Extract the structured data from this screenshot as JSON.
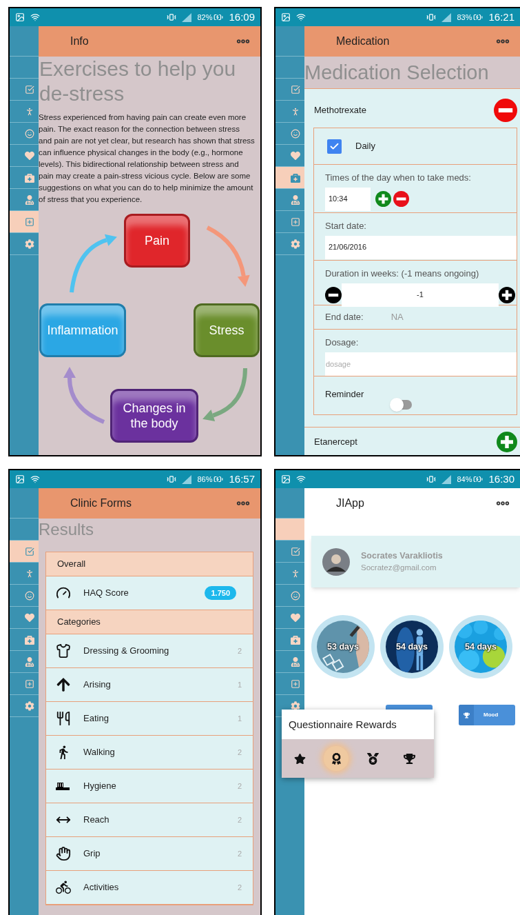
{
  "panels": [
    {
      "kind": "info",
      "status": {
        "battery": "82%",
        "time": "16:09"
      },
      "header": {
        "title": "Info"
      },
      "sidebar": [
        {
          "kind": "blank",
          "selected": false
        },
        {
          "kind": "checklist",
          "selected": false
        },
        {
          "kind": "person",
          "selected": false
        },
        {
          "kind": "smiley",
          "selected": false
        },
        {
          "kind": "heart",
          "selected": false
        },
        {
          "kind": "medkit",
          "selected": false
        },
        {
          "kind": "doctor",
          "selected": false
        },
        {
          "kind": "plus",
          "selected": true
        },
        {
          "kind": "gear",
          "selected": false
        }
      ],
      "title": "Exercises to help you de-stress",
      "paragraph": "Stress experienced from having pain can create even more pain. The exact reason for the connection between stress and pain are not yet clear, but research has shown that stress can influence physical changes in the body (e.g., hormone levels). This bidirectional relationship between stress and pain may create a pain-stress vicious cycle. Below are some suggestions on what you can do to help minimize the amount of stress that you experience.",
      "diagram": {
        "nodes": [
          {
            "label": "Pain",
            "color": "#e0262b"
          },
          {
            "label": "Stress",
            "color": "#6a8e2c"
          },
          {
            "label": "Changes in the body",
            "color": "#6b319e"
          },
          {
            "label": "Inflammation",
            "color": "#2ba7e4"
          }
        ],
        "arrows": [
          {
            "color": "#f4977a"
          },
          {
            "color": "#7aa880"
          },
          {
            "color": "#a48ccc"
          },
          {
            "color": "#4fc3f0"
          }
        ]
      }
    },
    {
      "kind": "medication",
      "status": {
        "battery": "83%",
        "time": "16:21"
      },
      "header": {
        "title": "Medication"
      },
      "sidebar": [
        {
          "kind": "blank",
          "selected": false
        },
        {
          "kind": "checklist",
          "selected": false
        },
        {
          "kind": "person",
          "selected": false
        },
        {
          "kind": "smiley",
          "selected": false
        },
        {
          "kind": "heart",
          "selected": false
        },
        {
          "kind": "medkit",
          "selected": true
        },
        {
          "kind": "doctor",
          "selected": false
        },
        {
          "kind": "plus",
          "selected": false
        },
        {
          "kind": "gear",
          "selected": false
        }
      ],
      "title": "Medication Selection",
      "medications": [
        {
          "name": "Methotrexate",
          "expanded": true,
          "daily": {
            "label": "Daily",
            "checked": true
          },
          "times_label": "Times of the day when to take meds:",
          "times": [
            "10:34"
          ],
          "start_label": "Start date:",
          "start_date": "21/06/2016",
          "duration_label": "Duration in weeks: (-1 means ongoing)",
          "duration": "-1",
          "end_label": "End date:",
          "end_date": "NA",
          "dosage_label": "Dosage:",
          "dosage_placeholder": "dosage",
          "reminder_label": "Reminder",
          "reminder_on": false
        },
        {
          "name": "Etanercept",
          "expanded": false
        }
      ]
    },
    {
      "kind": "clinic",
      "status": {
        "battery": "86%",
        "time": "16:57"
      },
      "header": {
        "title": "Clinic Forms"
      },
      "sidebar": [
        {
          "kind": "blank",
          "selected": false
        },
        {
          "kind": "checklist",
          "selected": true
        },
        {
          "kind": "person",
          "selected": false
        },
        {
          "kind": "smiley",
          "selected": false
        },
        {
          "kind": "heart",
          "selected": false
        },
        {
          "kind": "medkit",
          "selected": false
        },
        {
          "kind": "doctor",
          "selected": false
        },
        {
          "kind": "plus",
          "selected": false
        },
        {
          "kind": "gear",
          "selected": false
        }
      ],
      "title": "Results",
      "sections": [
        {
          "header": "Overall",
          "rows": [
            {
              "kind": "gauge",
              "label": "HAQ Score",
              "badge": "1.750"
            }
          ]
        },
        {
          "header": "Categories",
          "rows": [
            {
              "kind": "shirt",
              "label": "Dressing & Grooming",
              "count": "2"
            },
            {
              "kind": "arrow_up",
              "label": "Arising",
              "count": "1"
            },
            {
              "kind": "fork",
              "label": "Eating",
              "count": "1"
            },
            {
              "kind": "walking",
              "label": "Walking",
              "count": "2"
            },
            {
              "kind": "toothbrush",
              "label": "Hygiene",
              "count": "2"
            },
            {
              "kind": "reach",
              "label": "Reach",
              "count": "2"
            },
            {
              "kind": "grip",
              "label": "Grip",
              "count": "2"
            },
            {
              "kind": "bike",
              "label": "Activities",
              "count": "2"
            }
          ]
        }
      ]
    },
    {
      "kind": "home",
      "status": {
        "battery": "84%",
        "time": "16:30"
      },
      "header": {
        "title": "JIApp"
      },
      "sidebar": [
        {
          "kind": "blank",
          "selected": true
        },
        {
          "kind": "checklist",
          "selected": false
        },
        {
          "kind": "person",
          "selected": false
        },
        {
          "kind": "smiley",
          "selected": false
        },
        {
          "kind": "heart",
          "selected": false
        },
        {
          "kind": "medkit",
          "selected": false
        },
        {
          "kind": "doctor",
          "selected": false
        },
        {
          "kind": "plus",
          "selected": false
        },
        {
          "kind": "gear",
          "selected": false
        }
      ],
      "profile": {
        "name": "Socrates Varakliotis",
        "email": "Socratez@gmail.com"
      },
      "streaks": [
        {
          "kind": "writing",
          "label": "53 days"
        },
        {
          "kind": "body",
          "label": "54 days"
        },
        {
          "kind": "smileys",
          "label": "54 days"
        }
      ],
      "buttons": [
        {
          "kind": "plain"
        },
        {
          "kind": "trophy",
          "label": "Mood"
        }
      ],
      "popup": {
        "title": "Questionnaire Rewards",
        "rewards": [
          {
            "kind": "star",
            "selected": false
          },
          {
            "kind": "ribbon",
            "selected": true
          },
          {
            "kind": "medal",
            "selected": false
          },
          {
            "kind": "trophy",
            "selected": false
          }
        ]
      }
    }
  ]
}
